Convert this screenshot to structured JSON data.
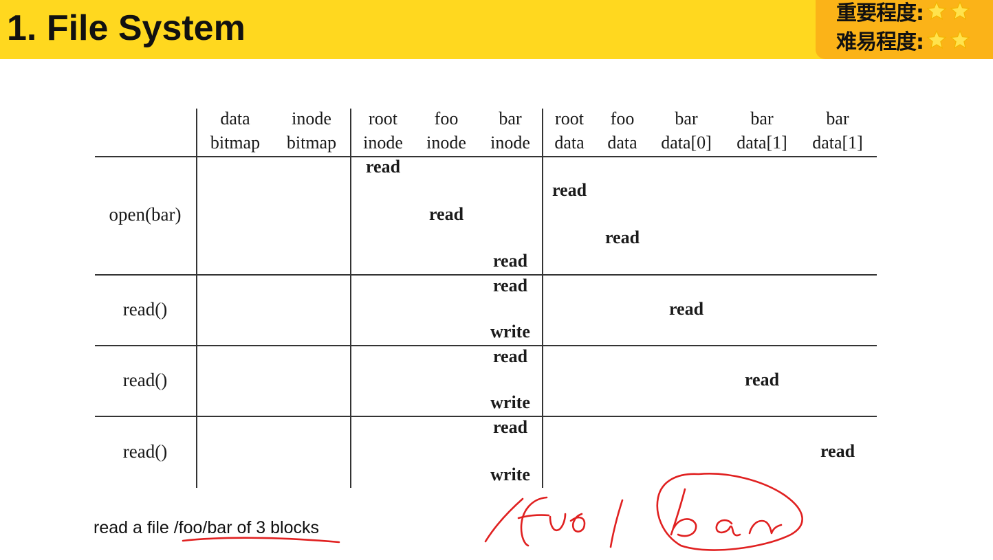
{
  "slide": {
    "title": "1. File System",
    "importance_label": "重要程度:",
    "difficulty_label": "难易程度:",
    "star_color": "#FFE34D"
  },
  "table": {
    "columns": [
      [
        "data",
        "bitmap"
      ],
      [
        "inode",
        "bitmap"
      ],
      [
        "root",
        "inode"
      ],
      [
        "foo",
        "inode"
      ],
      [
        "bar",
        "inode"
      ],
      [
        "root",
        "data"
      ],
      [
        "foo",
        "data"
      ],
      [
        "bar",
        "data[0]"
      ],
      [
        "bar",
        "data[1]"
      ],
      [
        "bar",
        "data[1]"
      ]
    ],
    "row_labels": [
      "open(bar)",
      "read()",
      "read()",
      "read()"
    ],
    "operations": [
      {
        "row": 0,
        "column": 2,
        "text": "read"
      },
      {
        "row": 0,
        "column": 5,
        "text": "read"
      },
      {
        "row": 0,
        "column": 3,
        "text": "read"
      },
      {
        "row": 0,
        "column": 6,
        "text": "read"
      },
      {
        "row": 0,
        "column": 4,
        "text": "read"
      },
      {
        "row": 1,
        "column": 4,
        "text": "read"
      },
      {
        "row": 1,
        "column": 7,
        "text": "read"
      },
      {
        "row": 1,
        "column": 4,
        "text": "write"
      },
      {
        "row": 2,
        "column": 4,
        "text": "read"
      },
      {
        "row": 2,
        "column": 8,
        "text": "read"
      },
      {
        "row": 2,
        "column": 4,
        "text": "write"
      },
      {
        "row": 3,
        "column": 4,
        "text": "read"
      },
      {
        "row": 3,
        "column": 9,
        "text": "read"
      },
      {
        "row": 3,
        "column": 4,
        "text": "write"
      }
    ]
  },
  "caption": "read a file /foo/bar of 3 blocks",
  "annotation": {
    "ink_color": "#E02020",
    "handwritten_text": "/foo/bar"
  }
}
